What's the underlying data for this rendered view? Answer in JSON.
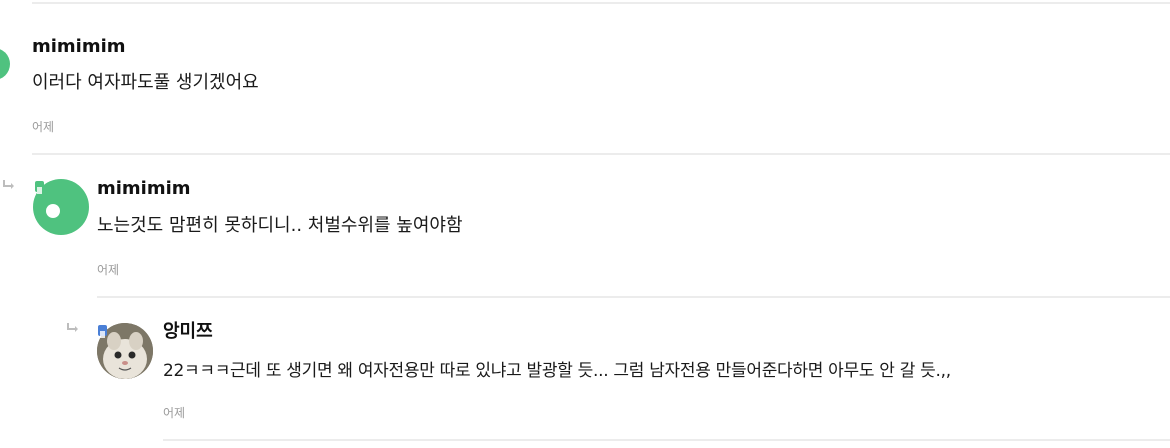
{
  "comments": [
    {
      "author": "mimimim",
      "text": "이러다 여자파도풀 생기겠어요",
      "time": "어제"
    },
    {
      "author": "mimimim",
      "text": "노는것도 맘편히 못하디니.. 처벌수위를 높여야함",
      "time": "어제"
    },
    {
      "author": "앙미쯔",
      "text": " 22ㅋㅋㅋ근데 또 생기면 왜 여자전용만 따로 있냐고 발광할 듯... 그럼 남자전용 만들어준다하면 아무도 안 갈 듯.,,",
      "time": "어제"
    }
  ],
  "colors": {
    "avatar_green": "#4fc27f",
    "badge_blue": "#4a7fd6",
    "divider": "#ececec"
  },
  "icons": {
    "reply": "reply-arrow-icon",
    "badge": "level-badge-icon"
  }
}
